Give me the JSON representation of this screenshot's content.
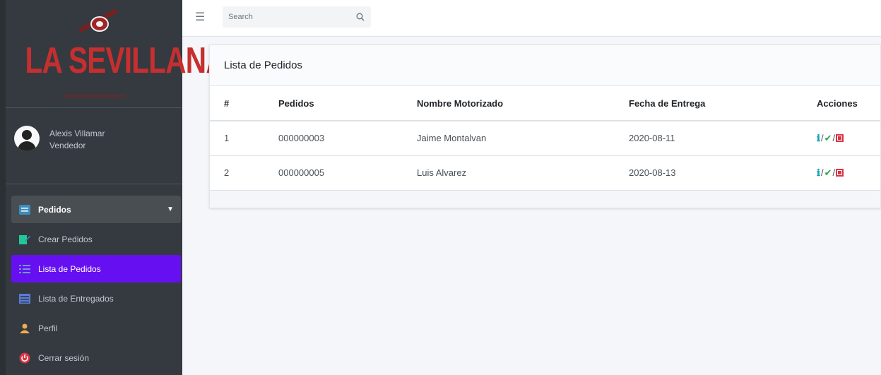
{
  "brand": {
    "title": "LA SEVILLANA",
    "accent": "#c62f2f"
  },
  "user": {
    "name": "Alexis Villamar",
    "role": "Vendedor"
  },
  "nav": {
    "items": [
      {
        "label": "Pedidos",
        "icon": "list-icon"
      },
      {
        "label": "Crear Pedidos",
        "icon": "edit-icon"
      },
      {
        "label": "Lista de Pedidos",
        "icon": "list-ul-icon"
      },
      {
        "label": "Lista de Entregados",
        "icon": "table-icon"
      },
      {
        "label": "Perfil",
        "icon": "user-icon"
      },
      {
        "label": "Cerrar sesión",
        "icon": "power-icon"
      }
    ],
    "active_color": "#6610f2"
  },
  "search": {
    "placeholder": "Search"
  },
  "card": {
    "title": "Lista de Pedidos"
  },
  "table": {
    "headers": [
      "#",
      "Pedidos",
      "Nombre Motorizado",
      "Fecha de Entrega",
      "Acciones"
    ],
    "rows": [
      {
        "num": "1",
        "pedido": "000000003",
        "motorizado": "Jaime Montalvan",
        "fecha": "2020-08-11"
      },
      {
        "num": "2",
        "pedido": "000000005",
        "motorizado": "Luis Alvarez",
        "fecha": "2020-08-13"
      }
    ],
    "action_separator": "/"
  }
}
